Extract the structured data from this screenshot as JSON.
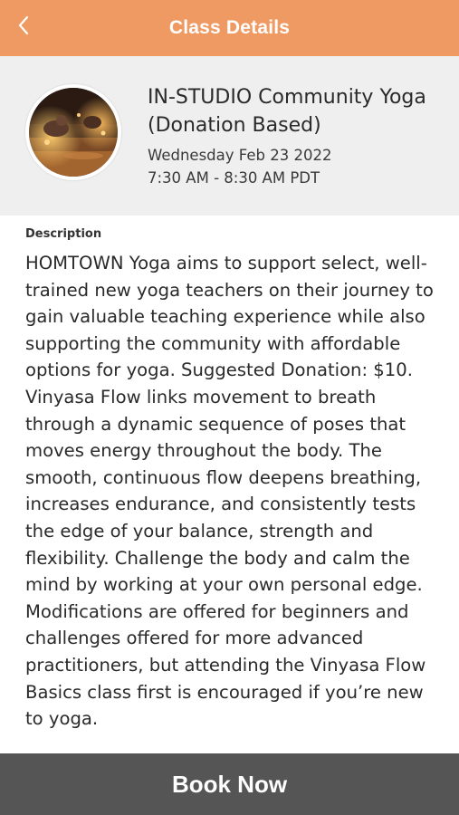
{
  "header": {
    "title": "Class Details",
    "back_icon": "chevron-left-icon",
    "color": "#ef9a62"
  },
  "class": {
    "name": "IN-STUDIO Community Yoga (Donation Based)",
    "date": "Wednesday Feb 23 2022",
    "time": "7:30 AM - 8:30 AM PDT",
    "image_alt": "yoga class photo"
  },
  "description": {
    "label": "Description",
    "text": "HOMTOWN Yoga aims to support select, well-trained new yoga teachers on their journey to gain valuable teaching experience while also supporting the community with affordable options for yoga. Suggested Donation: $10. Vinyasa Flow links movement to breath through a dynamic sequence of poses that moves energy throughout the body. The smooth, continuous flow deepens breathing, increases endurance, and consistently tests the edge of your balance, strength and flexibility. Challenge the body and calm the mind by working at your own personal edge. Modifications are offered for beginners and challenges offered for more advanced practitioners, but attending the Vinyasa Flow Basics class first is encouraged if you’re new to yoga."
  },
  "footer": {
    "book_label": "Book Now",
    "color": "#555556"
  }
}
